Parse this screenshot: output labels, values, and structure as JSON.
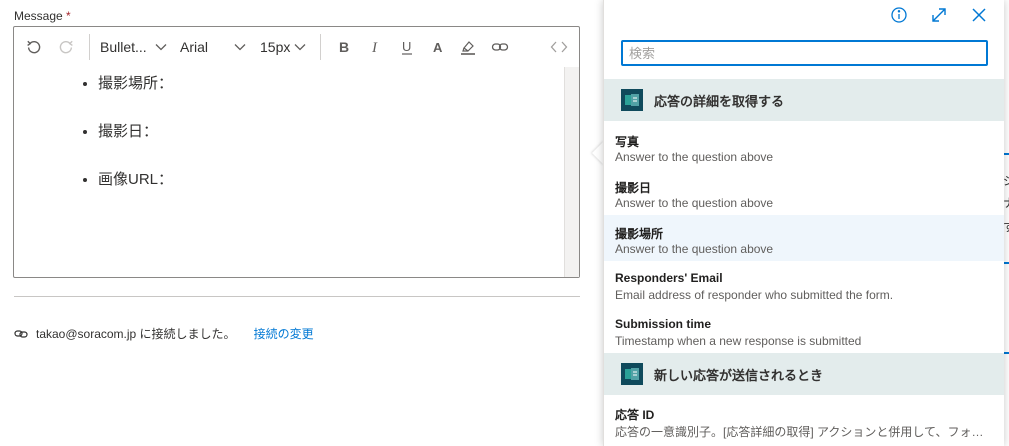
{
  "editor": {
    "label": "Message",
    "required_mark": "*",
    "toolbar": {
      "format_value": "Bullet...",
      "font_value": "Arial",
      "size_value": "15px"
    },
    "bullets": [
      "撮影場所：",
      "撮影日：",
      "画像URL："
    ]
  },
  "connection": {
    "account": "takao@soracom.jp に接続しました。",
    "change_label": "接続の変更"
  },
  "background_fragments": [
    "ジ",
    "ナ",
    "す"
  ],
  "popup": {
    "search_placeholder": "検索",
    "groups": [
      {
        "title": "応答の詳細を取得する",
        "items": [
          {
            "title": "写真",
            "desc": "Answer to the question above"
          },
          {
            "title": "撮影日",
            "desc": "Answer to the question above"
          },
          {
            "title": "撮影場所",
            "desc": "Answer to the question above"
          },
          {
            "title": "Responders' Email",
            "desc": "Email address of responder who submitted the form."
          },
          {
            "title": "Submission time",
            "desc": "Timestamp when a new response is submitted"
          }
        ]
      },
      {
        "title": "新しい応答が送信されるとき",
        "items": [
          {
            "title": "応答 ID",
            "desc": "応答の一意識別子。[応答詳細の取得] アクションと併用して、フォーム応答の詳細を取得します。"
          }
        ]
      }
    ]
  },
  "colors": {
    "accent": "#0078d4",
    "group_bg": "#e3ecec",
    "highlight": "#eff6fc"
  }
}
